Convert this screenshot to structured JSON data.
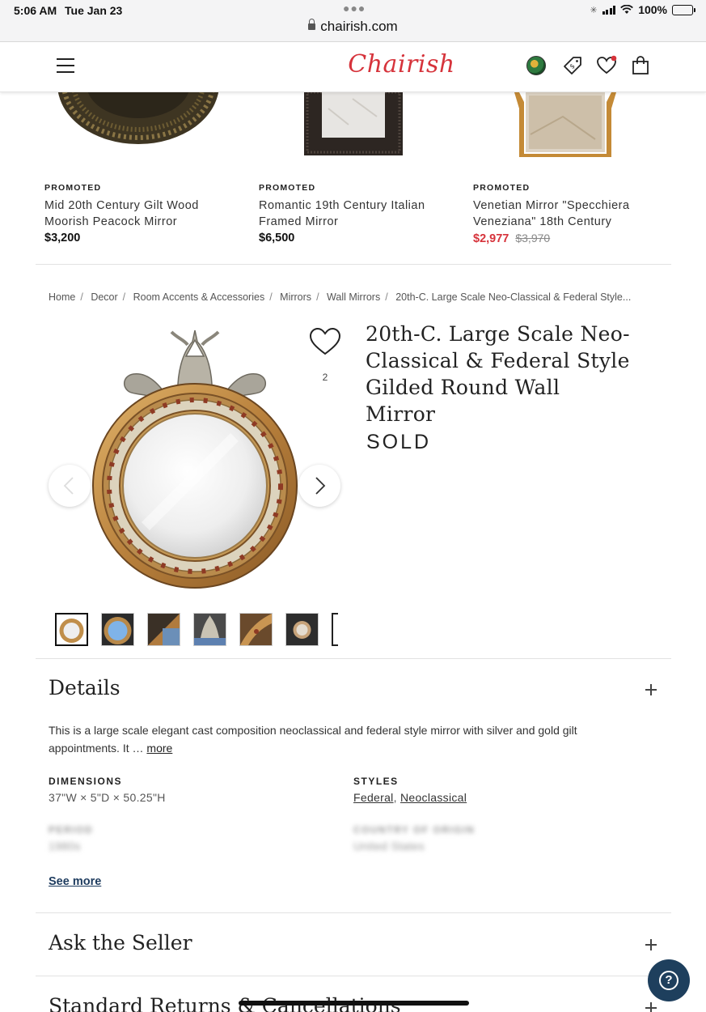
{
  "status_bar": {
    "time": "5:06 AM",
    "date": "Tue Jan 23",
    "url": "chairish.com",
    "battery": "100%",
    "battery_level": 1.0
  },
  "header": {
    "logo": "Chairish",
    "icons": [
      "hamburger-menu-icon",
      "avatar",
      "price-tag-icon",
      "heart-icon",
      "shopping-bag-icon"
    ],
    "notification_color": "#d6333b"
  },
  "promoted": [
    {
      "tag": "PROMOTED",
      "title": "Mid 20th Century Gilt Wood Moorish Peacock Mirror",
      "price": "$3,200"
    },
    {
      "tag": "PROMOTED",
      "title": "Romantic 19th Century Italian Framed Mirror",
      "price": "$6,500"
    },
    {
      "tag": "PROMOTED",
      "title": "Venetian Mirror \"Specchiera Veneziana\" 18th Century",
      "price": "$2,977",
      "original_price": "$3,970"
    }
  ],
  "breadcrumb": [
    "Home",
    "Decor",
    "Room Accents & Accessories",
    "Mirrors",
    "Wall Mirrors",
    "20th-C. Large Scale Neo-Classical & Federal Style..."
  ],
  "product": {
    "title": "20th-C. Large Scale Neo-Classical & Federal Style Gilded Round Wall Mirror",
    "status": "SOLD",
    "favorites": "2"
  },
  "details": {
    "heading": "Details",
    "description": "This is a large scale elegant cast composition neoclassical and federal style mirror with silver and gold gilt appointments. It …",
    "more_link": "more",
    "dimensions_label": "DIMENSIONS",
    "dimensions": "37\"W × 5\"D × 50.25\"H",
    "styles_label": "STYLES",
    "styles": [
      "Federal",
      "Neoclassical"
    ],
    "period_label": "PERIOD",
    "period": "1980s",
    "origin_label": "COUNTRY OF ORIGIN",
    "origin": "United States",
    "see_more": "See more"
  },
  "sections": {
    "ask_seller": "Ask the Seller",
    "returns": "Standard Returns & Cancellations"
  },
  "colors": {
    "brand": "#d6333b",
    "link_navy": "#1d3b5e",
    "help_button": "#1e3f5d"
  }
}
